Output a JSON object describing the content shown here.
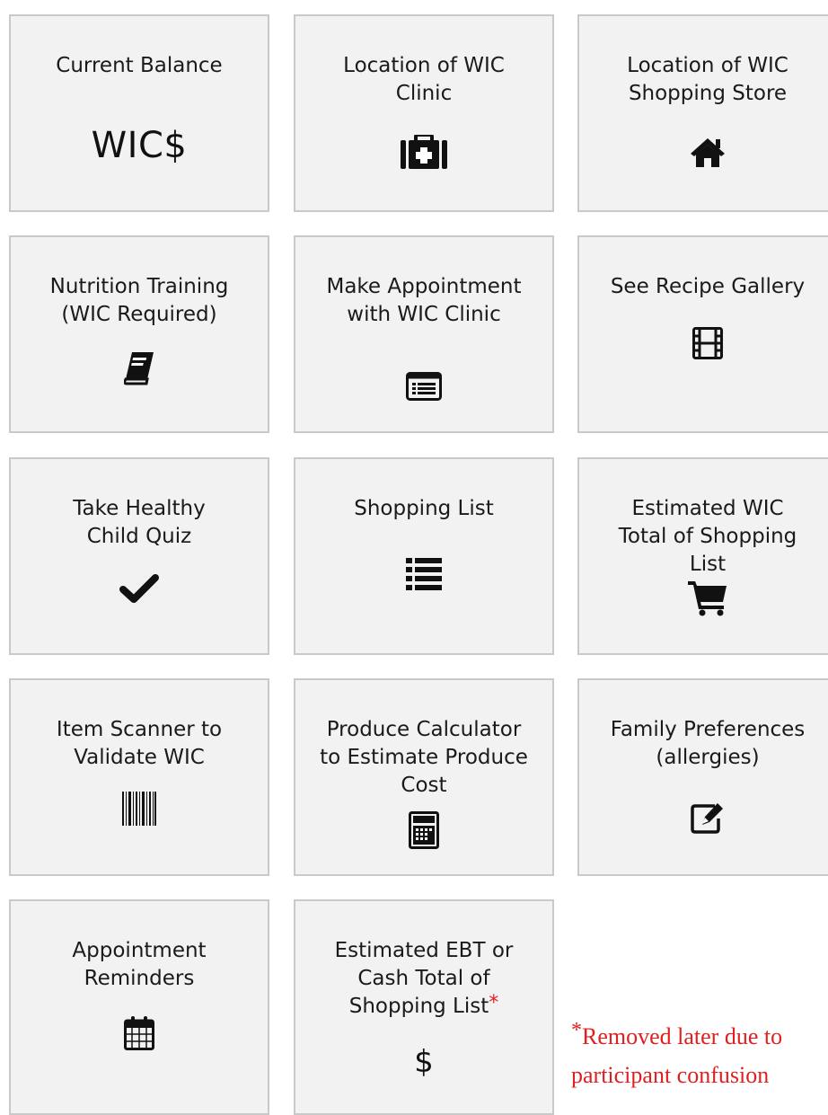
{
  "tiles": [
    {
      "label": "Current Balance",
      "display": "WIC$",
      "icon": "wic-dollar-text"
    },
    {
      "label": "Location of WIC Clinic",
      "icon": "medkit-icon"
    },
    {
      "label": "Location of WIC Shopping Store",
      "icon": "home-icon"
    },
    {
      "label": "Nutrition Training (WIC Required)",
      "icon": "book-icon"
    },
    {
      "label": "Make Appointment with WIC Clinic",
      "icon": "list-alt-icon"
    },
    {
      "label": "See Recipe Gallery",
      "icon": "film-icon"
    },
    {
      "label": "Take Healthy Child Quiz",
      "icon": "check-icon"
    },
    {
      "label": "Shopping List",
      "icon": "list-icon"
    },
    {
      "label": "Estimated WIC Total of Shopping List",
      "icon": "cart-icon"
    },
    {
      "label": "Item Scanner to Validate WIC",
      "icon": "barcode-icon"
    },
    {
      "label": "Produce Calculator to Estimate Produce Cost",
      "icon": "calculator-icon"
    },
    {
      "label": "Family Preferences (allergies)",
      "icon": "edit-icon"
    },
    {
      "label": "Appointment Reminders",
      "icon": "calendar-icon"
    },
    {
      "label": "Estimated EBT or Cash Total of Shopping List",
      "asterisk": "*",
      "display": "$",
      "icon": "dollar-icon"
    }
  ],
  "note": {
    "asterisk": "*",
    "text": "Removed later due to participant confusion"
  },
  "colors": {
    "tile_bg": "#f2f2f2",
    "tile_border": "#c9c9c9",
    "note": "#e02020",
    "icon": "#111111"
  }
}
